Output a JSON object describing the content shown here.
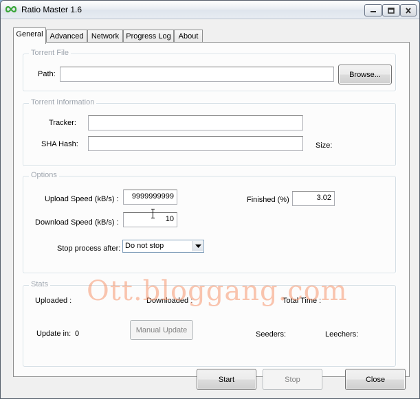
{
  "window": {
    "title": "Ratio Master 1.6",
    "icon": "infinity-icon",
    "controls": {
      "minimize": "minimize-icon",
      "maximize": "maximize-icon",
      "close": "close-icon"
    }
  },
  "tabs": [
    "General",
    "Advanced",
    "Network",
    "Progress Log",
    "About"
  ],
  "active_tab": "General",
  "torrent_file": {
    "legend": "Torrent File",
    "path_label": "Path:",
    "path_value": "",
    "browse_label": "Browse..."
  },
  "torrent_info": {
    "legend": "Torrent Information",
    "tracker_label": "Tracker:",
    "tracker_value": "",
    "sha_label": "SHA Hash:",
    "sha_value": "",
    "size_label": "Size:"
  },
  "options": {
    "legend": "Options",
    "upload_label": "Upload Speed (kB/s) :",
    "upload_value": "9999999999",
    "download_label": "Download Speed (kB/s) :",
    "download_value": "10",
    "finished_label": "Finished (%)",
    "finished_value": "3.02",
    "stop_label": "Stop process after:",
    "stop_value": "Do not stop"
  },
  "stats": {
    "legend": "Stats",
    "uploaded_label": "Uploaded :",
    "downloaded_label": "Downloaded :",
    "total_time_label": "Total Time :",
    "update_in_label": "Update in:",
    "update_in_value": "0",
    "manual_update_label": "Manual Update",
    "seeders_label": "Seeders:",
    "leechers_label": "Leechers:"
  },
  "buttons": {
    "start": "Start",
    "stop": "Stop",
    "close": "Close"
  },
  "watermark": "Ott.bloggang.com",
  "colors": {
    "icon_green": "#3aa63a",
    "watermark": "#f5966e",
    "legend_gray": "#a0a7b0"
  }
}
